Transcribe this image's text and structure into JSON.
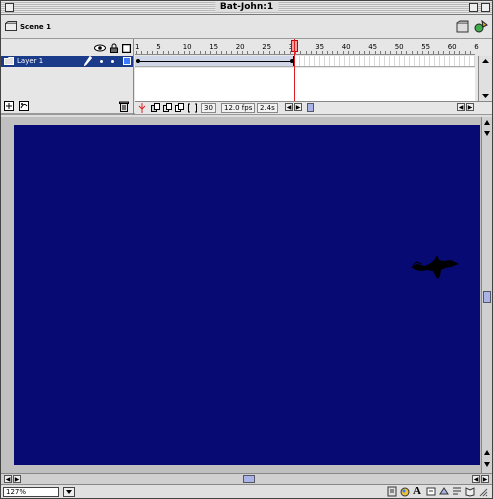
{
  "window": {
    "title": "Bat-John:1"
  },
  "scene": {
    "label": "Scene 1"
  },
  "layers": [
    {
      "name": "Layer 1",
      "color": "#3a7bff"
    }
  ],
  "timeline": {
    "ruler_numbers": [
      "1",
      "5",
      "10",
      "15",
      "20",
      "25",
      "30",
      "35",
      "40",
      "45",
      "50",
      "55",
      "60",
      "6"
    ],
    "current_frame": "30",
    "frame_rate": "12.0 fps",
    "elapsed_time": "2.4s"
  },
  "stage": {
    "background_color": "#080a73"
  },
  "status": {
    "zoom_value": "127%"
  },
  "icons": {
    "eye": "eye-icon",
    "lock": "lock-icon",
    "outline": "outline-icon",
    "pencil": "pencil-icon",
    "trash": "trash-icon"
  }
}
